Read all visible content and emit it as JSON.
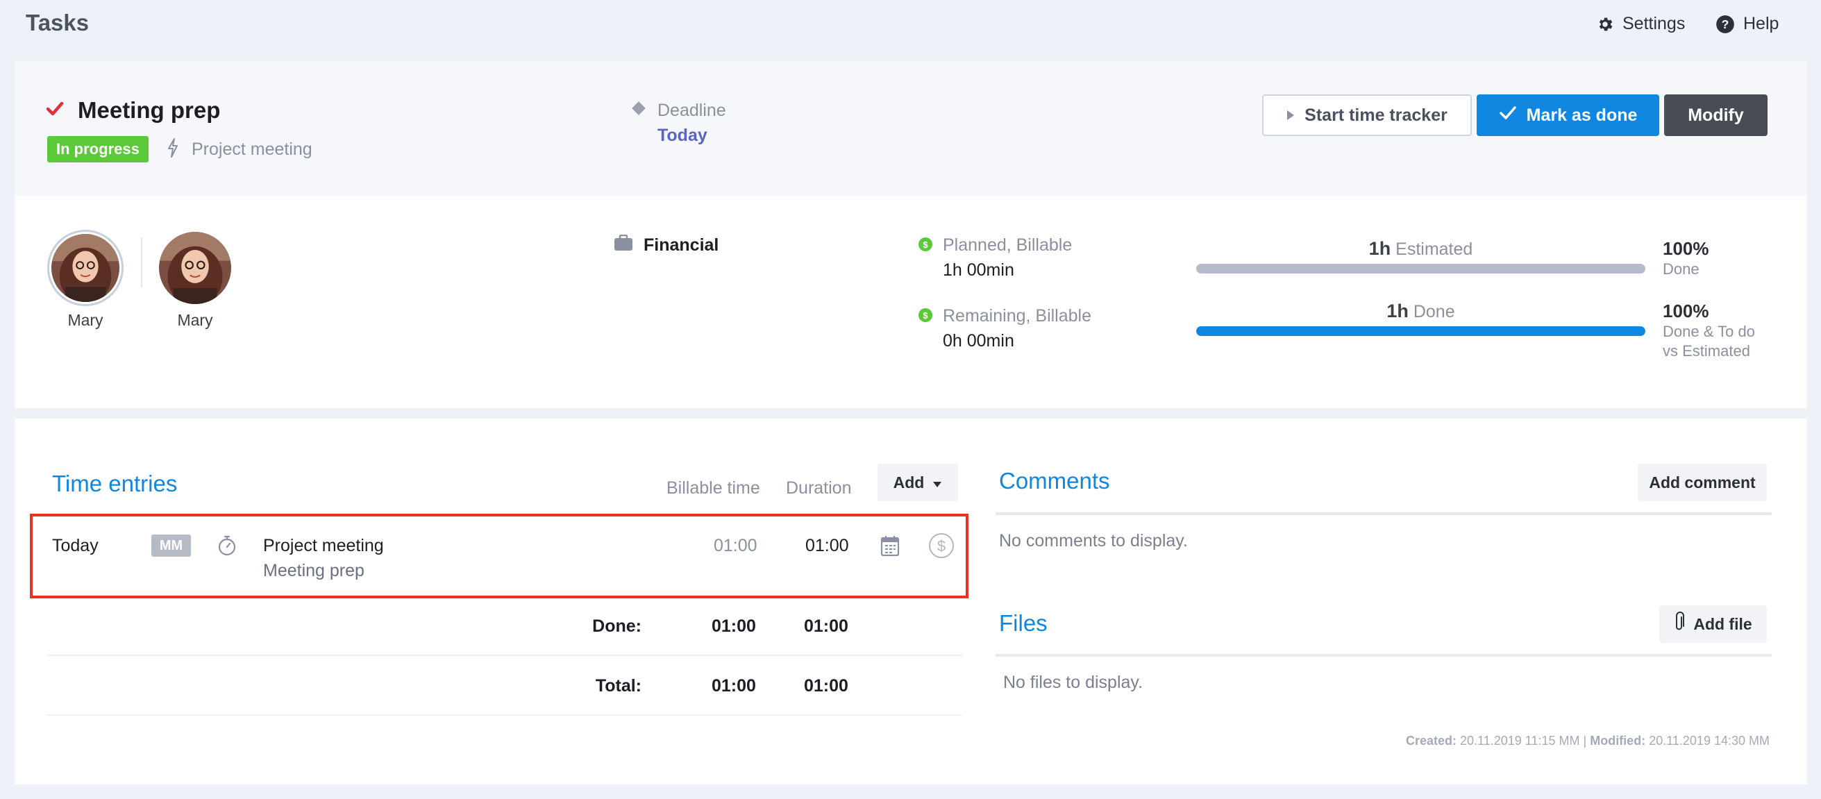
{
  "app": {
    "title": "Tasks",
    "settings_label": "Settings",
    "help_label": "Help"
  },
  "task": {
    "title": "Meeting prep",
    "status": "In progress",
    "project": "Project meeting",
    "deadline_label": "Deadline",
    "deadline_value": "Today"
  },
  "actions": {
    "start_tracker": "Start time tracker",
    "mark_done": "Mark as done",
    "modify": "Modify"
  },
  "assignees": [
    {
      "name": "Mary"
    },
    {
      "name": "Mary"
    }
  ],
  "category": "Financial",
  "stats": {
    "planned_label": "Planned, Billable",
    "planned_value": "1h 00min",
    "remaining_label": "Remaining, Billable",
    "remaining_value": "0h 00min"
  },
  "progress": {
    "estimated": {
      "amount": "1h",
      "label": "Estimated",
      "fraction": 1.0,
      "pct": "100%",
      "caption": "Done",
      "color": "#b4bccb"
    },
    "done": {
      "amount": "1h",
      "label": "Done",
      "fraction": 1.0,
      "pct": "100%",
      "caption_1": "Done & To do",
      "caption_2": "vs Estimated",
      "color": "#0f86e0"
    }
  },
  "time_entries": {
    "title": "Time entries",
    "col_billable": "Billable time",
    "col_duration": "Duration",
    "add_label": "Add",
    "entry": {
      "date": "Today",
      "initials": "MM",
      "project": "Project meeting",
      "task": "Meeting prep",
      "billable": "01:00",
      "duration": "01:00"
    },
    "done_label": "Done:",
    "done_billable": "01:00",
    "done_duration": "01:00",
    "total_label": "Total:",
    "total_billable": "01:00",
    "total_duration": "01:00"
  },
  "comments": {
    "title": "Comments",
    "add_label": "Add comment",
    "empty": "No comments to display."
  },
  "files": {
    "title": "Files",
    "add_label": "Add file",
    "empty": "No files to display."
  },
  "meta": {
    "created_label": "Created:",
    "created_value": "20.11.2019 11:15 MM",
    "separator": "|",
    "modified_label": "Modified:",
    "modified_value": "20.11.2019 14:30 MM"
  },
  "colors": {
    "accent": "#0f86e0",
    "status_green": "#5cc93a",
    "highlight_border": "#e8341f",
    "deadline": "#5a64c4"
  },
  "icons": [
    "gear-icon",
    "help-icon",
    "check-icon",
    "lightning-icon",
    "diamond-icon",
    "play-icon",
    "briefcase-icon",
    "dollar-icon",
    "stopwatch-icon",
    "calendar-icon",
    "caret-down-icon",
    "paperclip-icon"
  ]
}
